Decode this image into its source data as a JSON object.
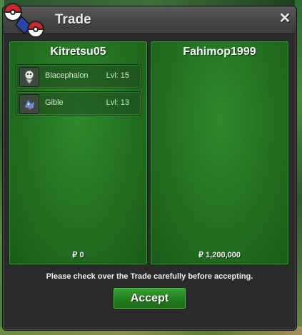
{
  "window": {
    "title": "Trade",
    "close_symbol": "✕"
  },
  "left_panel": {
    "player": "Kitretsu05",
    "items": [
      {
        "name": "Blacephalon",
        "level": "Lvl: 15",
        "icon": "blacephalon-sprite-icon"
      },
      {
        "name": "Gible",
        "level": "Lvl: 13",
        "icon": "gible-sprite-icon"
      }
    ],
    "money": "₽ 0"
  },
  "right_panel": {
    "player": "Fahimop1999",
    "items": [],
    "money": "₽ 1,200,000"
  },
  "notice": "Please check over the Trade carefully before accepting.",
  "accept_label": "Accept",
  "colors": {
    "panel_green": "#2f8a2c",
    "button_green": "#35a131",
    "window_bg": "#2b2b2b"
  }
}
